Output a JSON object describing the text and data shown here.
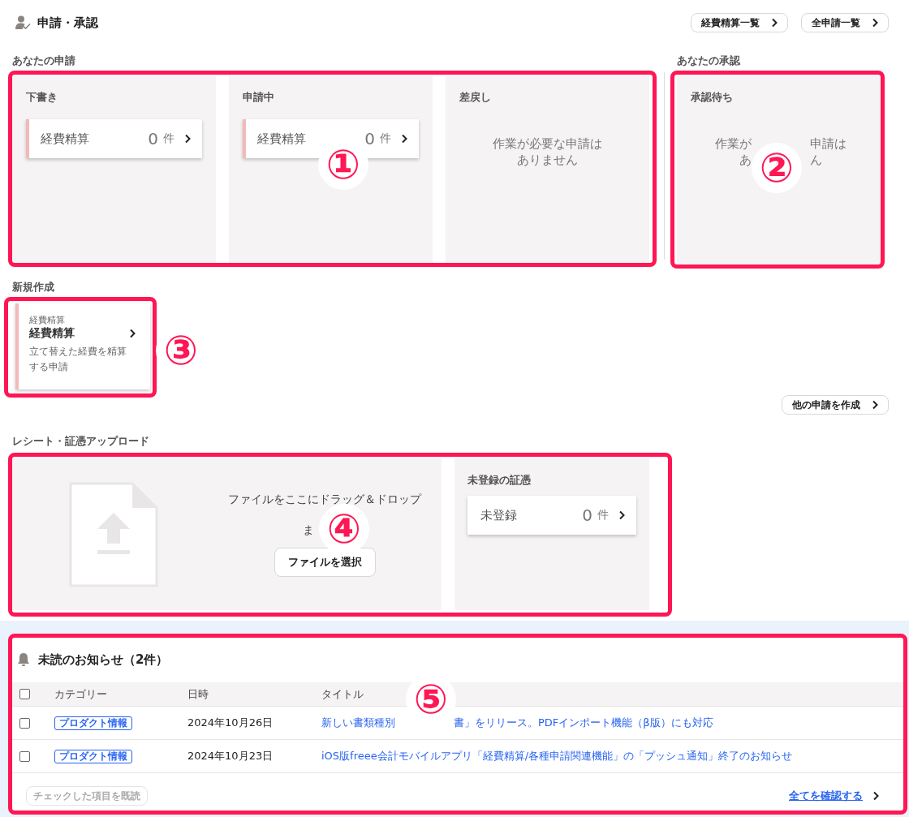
{
  "header": {
    "title": "申請・承認",
    "buttons": [
      "経費精算一覧",
      "全申請一覧"
    ]
  },
  "my_requests": {
    "label": "あなたの申請",
    "panels": [
      {
        "title": "下書き",
        "kind": "cards",
        "cards": [
          {
            "label": "経費精算",
            "count": "0",
            "unit": "件"
          }
        ]
      },
      {
        "title": "申請中",
        "kind": "cards",
        "cards": [
          {
            "label": "経費精算",
            "count": "0",
            "unit": "件"
          }
        ]
      },
      {
        "title": "差戻し",
        "kind": "empty",
        "lines": [
          [
            "作業が必要な申請は"
          ],
          [
            "ありません"
          ]
        ]
      }
    ]
  },
  "my_approvals": {
    "label": "あなたの承認",
    "panels": [
      {
        "title": "承認待ち",
        "kind": "empty",
        "lines": [
          [
            "作業が",
            "申請は"
          ],
          [
            "あ",
            "ん"
          ]
        ]
      }
    ]
  },
  "new_request": {
    "label": "新規作成",
    "templates": [
      {
        "category": "経費精算",
        "name": "経費精算",
        "description": "立て替えた経費を精算する申請"
      }
    ],
    "more_button": "他の申請を作成"
  },
  "upload": {
    "label": "レシート・証憑アップロード",
    "drop_text": "ファイルをここにドラッグ＆ドロップ",
    "or_text": "ま",
    "select_button": "ファイルを選択",
    "unregistered": {
      "title": "未登録の証憑",
      "cards": [
        {
          "label": "未登録",
          "count": "0",
          "unit": "件"
        }
      ]
    }
  },
  "notifications": {
    "title": "未読のお知らせ（2件）",
    "columns": [
      "カテゴリー",
      "日時",
      "タイトル"
    ],
    "header_checked": false,
    "rows": [
      {
        "checked": false,
        "category": "プロダクト情報",
        "date": "2024年10月26日",
        "title_parts": [
          "新しい書類種別",
          "書」をリリース。PDFインポート機能（β版）にも対応"
        ]
      },
      {
        "checked": false,
        "category": "プロダクト情報",
        "date": "2024年10月23日",
        "title_parts": [
          "iOS版freee会計モバイルアプリ「経費精算/各種申請関連機能」の「プッシュ通知」終了のお知らせ"
        ]
      }
    ],
    "mark_read_button": {
      "label": "チェックした項目を既読",
      "disabled": true
    },
    "view_all_link": "全てを確認する"
  },
  "annotations": [
    {
      "label": "①"
    },
    {
      "label": "②"
    },
    {
      "label": "③"
    },
    {
      "label": "④"
    },
    {
      "label": "⑤"
    }
  ]
}
